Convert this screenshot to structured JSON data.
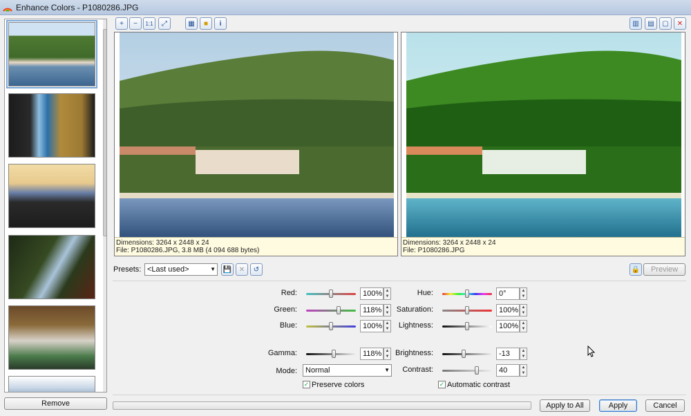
{
  "window": {
    "title": "Enhance Colors - P1080286.JPG"
  },
  "thumbnails": [
    "lake-hillside",
    "hotel-room",
    "person-railing",
    "tree-foliage",
    "child-restaurant",
    "sky-edge"
  ],
  "sidebar": {
    "remove_label": "Remove"
  },
  "toolbar": {
    "left_icons": [
      "zoom-in-icon",
      "zoom-out-icon",
      "actual-size-icon",
      "fit-window-icon",
      "picture-icon",
      "highlight-icon",
      "info-icon"
    ],
    "right_icons": [
      "split-vertical-icon",
      "split-horizontal-icon",
      "single-view-icon",
      "close-view-icon"
    ]
  },
  "original": {
    "dimensions": "Dimensions: 3264 x 2448 x 24",
    "file": "File: P1080286.JPG, 3.8 MB (4 094 688 bytes)"
  },
  "preview_panel": {
    "dimensions": "Dimensions: 3264 x 2448 x 24",
    "file": "File: P1080286.JPG"
  },
  "presets": {
    "label": "Presets:",
    "selected": "<Last used>"
  },
  "preview_button": "Preview",
  "controls": {
    "red": {
      "label": "Red:",
      "value": "100%",
      "level": 0.5
    },
    "green": {
      "label": "Green:",
      "value": "118%",
      "level": 0.65
    },
    "blue": {
      "label": "Blue:",
      "value": "100%",
      "level": 0.5
    },
    "gamma": {
      "label": "Gamma:",
      "value": "118%",
      "level": 0.55
    },
    "mode": {
      "label": "Mode:",
      "selected": "Normal"
    },
    "preserve_colors": {
      "label": "Preserve colors",
      "checked": true
    },
    "hue": {
      "label": "Hue:",
      "value": "0°",
      "level": 0.5
    },
    "saturation": {
      "label": "Saturation:",
      "value": "100%",
      "level": 0.5
    },
    "lightness": {
      "label": "Lightness:",
      "value": "100%",
      "level": 0.5
    },
    "brightness": {
      "label": "Brightness:",
      "value": "-13",
      "level": 0.43
    },
    "contrast": {
      "label": "Contrast:",
      "value": "40",
      "level": 0.7
    },
    "automatic_contrast": {
      "label": "Automatic contrast",
      "checked": true
    }
  },
  "footer": {
    "apply_all": "Apply to All",
    "apply": "Apply",
    "cancel": "Cancel"
  }
}
